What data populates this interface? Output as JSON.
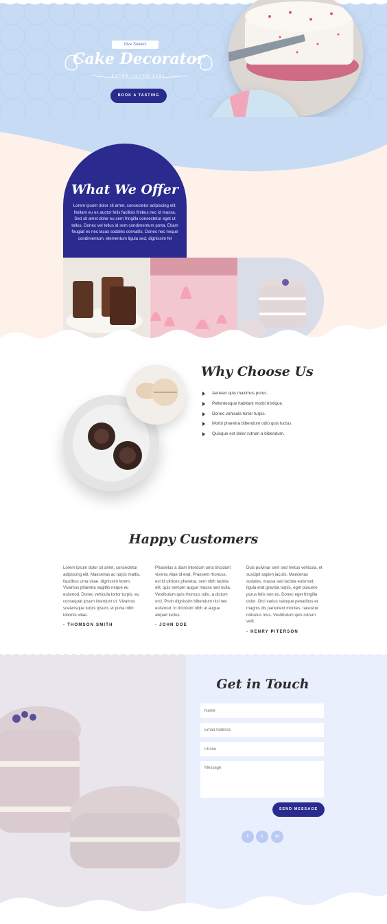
{
  "hero": {
    "tagline": "Dive Sweets",
    "title": "Cake Decorator",
    "established": "ESTABLISHED 1996",
    "cta_label": "BOOK A TASTING"
  },
  "offer": {
    "title": "What We Offer",
    "body": "Lorem ipsum dolor sit amet, consectetur adipiscing elit. Nullam eu ex auctor felis facilisis finibus nec id massa. Sed sit amet dolor eu sem fringilla consectetur eget ut tellus. Donec vel tellus id sem condimentum porta. Etiam feugiat ex nec lacus sodales convallis. Donec nec neque condimentum, elementum ligula sed, dignissim fel"
  },
  "why": {
    "title": "Why Choose Us",
    "items": [
      "Aenean quis maximus purus.",
      "Pellentesque habitant morbi tristique.",
      "Donec vehicula tortor turpis.",
      "Morbi pharetra bibendum odio quis luctus.",
      "Quisque est dolor rutrum a bibendum."
    ]
  },
  "testimonials": {
    "title": "Happy Customers",
    "items": [
      {
        "text": "Lorem ipsum dolor sit amet, consectetur adipiscing elit. Maecenas ac turpis mattis, faucibus urna vitae, dignissim lorem. Vivamus pharetra sagittis neque eu euismod. Donec vehicula tortor turpis, eu consequat ipsum interdum ut. Vivamus scelerisque turpis ipsum, et porta nibh lobortis vitae.",
        "author": "- THOMSON SMITH"
      },
      {
        "text": "Phasellus a diam interdum urna tincidunt viverra vitae id erat. Praesent rhoncus, est id ultrices pharetra, sem nibh lacinia elit, quis semper augue massa sed nulla. Vestibulum quis rhoncus odio, a dictum orci. Proin dignissim bibendum nisl nec euismod. In tincidunt nibh ut augue aliquet luctus.",
        "author": "- JOHN DOE"
      },
      {
        "text": "Duis pulvinar sem sed metus vehicula, et suscipit sapien iaculis. Maecenas sodales, massa sed lacinia euismod, ligula erat gravida turpis, eget posuere purus felis non ex. Donec eget fringilla dolor. Orci varius natoque penatibus et magnis dis parturient montes, nascetur ridiculus mus. Vestibulum quis rutrum velit.",
        "author": "- HENRY PITERSON"
      }
    ]
  },
  "contact": {
    "title": "Get in Touch",
    "name_placeholder": "Name",
    "email_placeholder": "Email Address",
    "phone_placeholder": "Phone",
    "message_placeholder": "Message",
    "send_label": "SEND MESSAGE",
    "social": [
      {
        "icon": "facebook-icon",
        "glyph": "f"
      },
      {
        "icon": "twitter-icon",
        "glyph": "t"
      },
      {
        "icon": "linkedin-icon",
        "glyph": "in"
      }
    ]
  },
  "colors": {
    "hero_bg": "#c7dbf4",
    "accent_navy": "#2a2b8d",
    "peach_bg": "#fdf1ea",
    "contact_bg": "#eaeffe"
  }
}
